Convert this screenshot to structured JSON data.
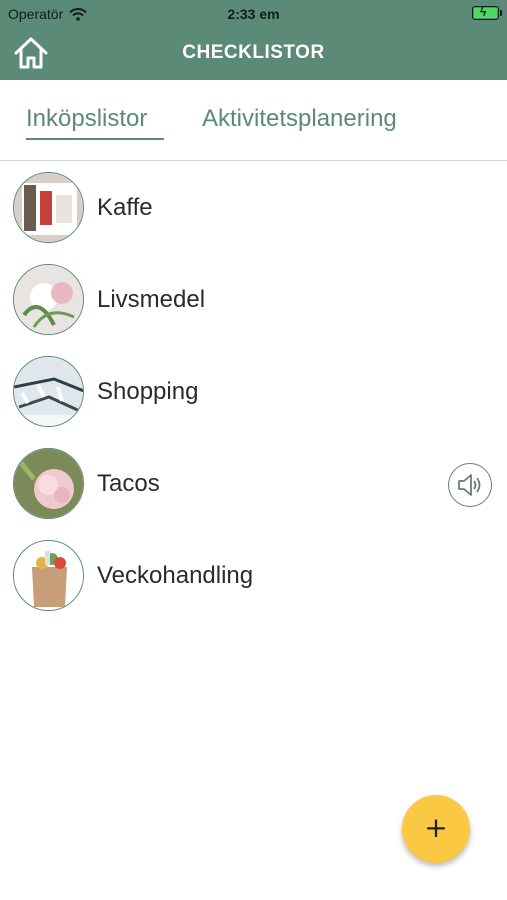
{
  "status_bar": {
    "carrier": "Operatör",
    "time": "2:33 em"
  },
  "nav": {
    "title": "CHECKLISTOR",
    "home_icon": "home-icon"
  },
  "tabs": [
    {
      "label": "Inköpslistor",
      "selected": true
    },
    {
      "label": "Aktivitetsplanering",
      "selected": false
    }
  ],
  "lists": [
    {
      "label": "Kaffe",
      "image": "coffee-photo",
      "has_audio": false
    },
    {
      "label": "Livsmedel",
      "image": "flowers-photo",
      "has_audio": false
    },
    {
      "label": "Shopping",
      "image": "snowy-branches-photo",
      "has_audio": false
    },
    {
      "label": "Tacos",
      "image": "pink-flower-photo",
      "has_audio": true
    },
    {
      "label": "Veckohandling",
      "image": "grocery-bag-photo",
      "has_audio": false
    }
  ],
  "fab": {
    "label": "+"
  },
  "colors": {
    "header": "#5b8a76",
    "accent": "#5b8a76",
    "fab": "#fbc844",
    "battery": "#4cd964"
  }
}
